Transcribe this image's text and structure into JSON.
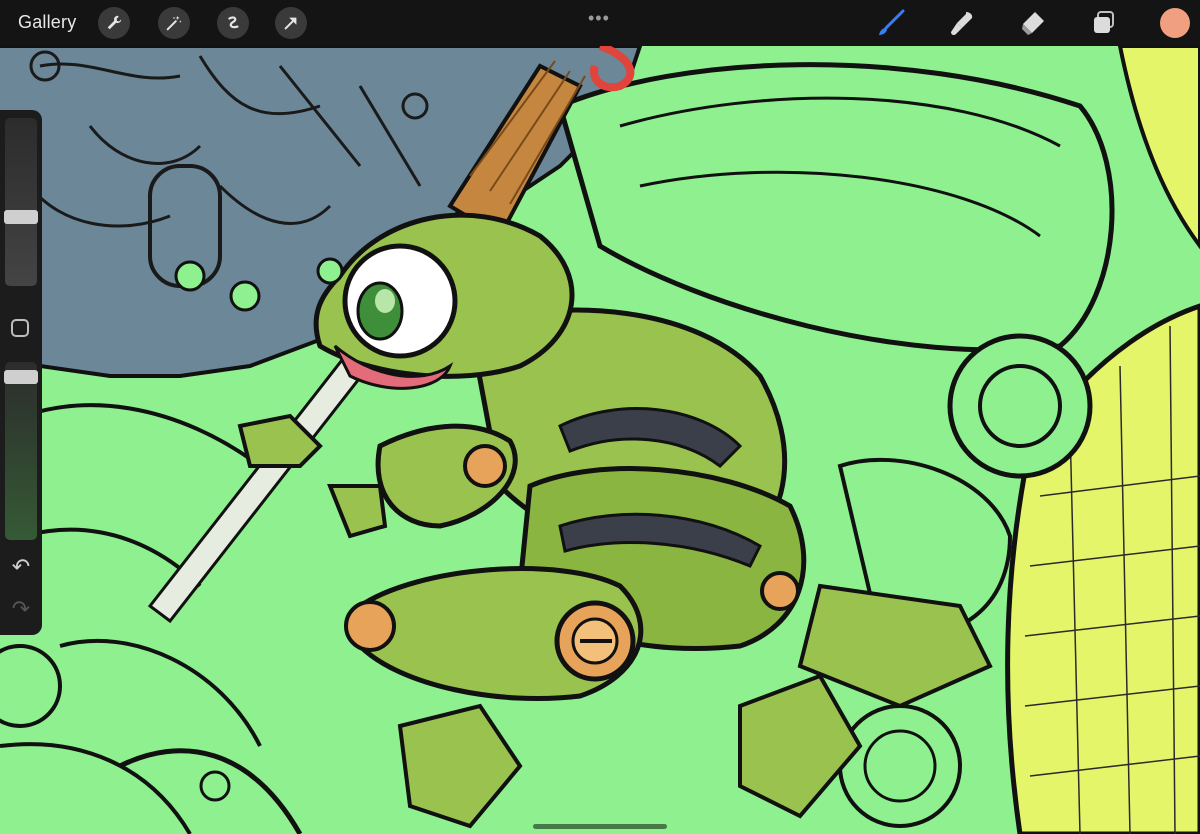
{
  "topbar": {
    "gallery_label": "Gallery",
    "left_tools": [
      {
        "icon": "wrench-icon",
        "name": "actions"
      },
      {
        "icon": "magic-wand-icon",
        "name": "adjustments"
      },
      {
        "icon": "selection-icon",
        "name": "selection"
      },
      {
        "icon": "arrow-icon",
        "name": "transform"
      }
    ],
    "more_dots": "•••",
    "right_tools": [
      {
        "icon": "brush-icon",
        "name": "brush",
        "active": true
      },
      {
        "icon": "smudge-icon",
        "name": "smudge"
      },
      {
        "icon": "eraser-icon",
        "name": "eraser"
      },
      {
        "icon": "layers-icon",
        "name": "layers"
      }
    ],
    "current_color": "#f0a080"
  },
  "sidebar": {
    "brush_size": 0.4,
    "opacity": 0.95,
    "undo_symbol": "↶",
    "redo_symbol": "↷"
  },
  "colors": {
    "canvas_green": "#8ef08e",
    "canvas_blue_gray": "#6b8798",
    "frog_green": "#9ac24e",
    "yellow_green": "#e4f56a",
    "orange_accent": "#e8a35a",
    "brush_active": "#3a7df0"
  }
}
